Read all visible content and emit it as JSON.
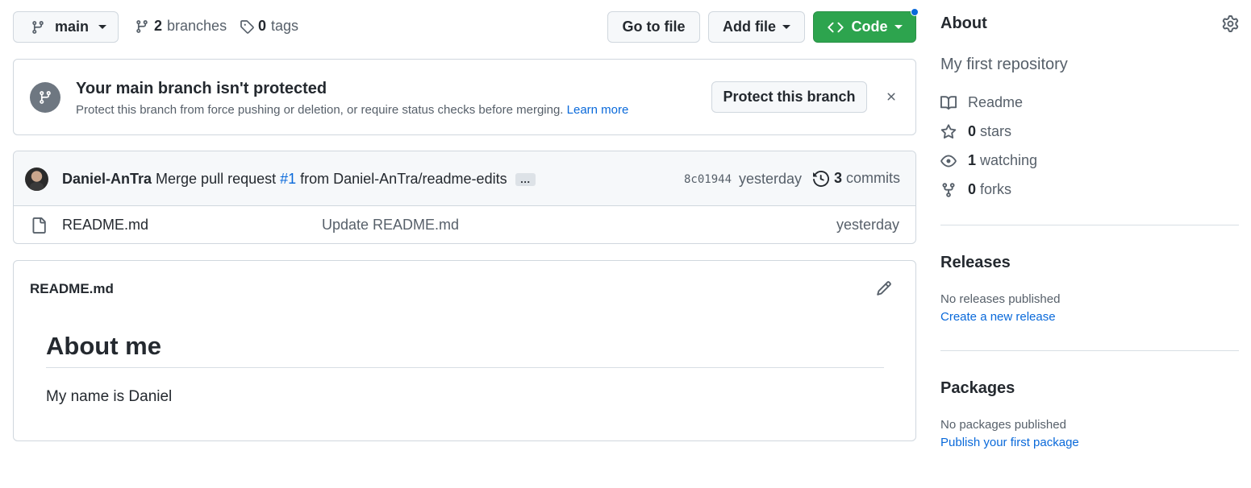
{
  "toolbar": {
    "branch_label": "main",
    "branches_count": "2",
    "branches_label": "branches",
    "tags_count": "0",
    "tags_label": "tags",
    "go_to_file": "Go to file",
    "add_file": "Add file",
    "code": "Code"
  },
  "protect_banner": {
    "title": "Your main branch isn't protected",
    "description": "Protect this branch from force pushing or deletion, or require status checks before merging.",
    "learn_more": "Learn more",
    "button": "Protect this branch"
  },
  "commit": {
    "author": "Daniel-AnTra",
    "message_prefix": "Merge pull request",
    "pr_number": "#1",
    "message_suffix": "from Daniel-AnTra/readme-edits",
    "ellipsis": "…",
    "sha": "8c01944",
    "time": "yesterday",
    "commits_count": "3",
    "commits_label": "commits"
  },
  "files": [
    {
      "name": "README.md",
      "message": "Update README.md",
      "time": "yesterday"
    }
  ],
  "readme": {
    "filename": "README.md",
    "heading": "About me",
    "body": "My name is Daniel"
  },
  "sidebar": {
    "about_title": "About",
    "description": "My first repository",
    "readme": "Readme",
    "stars_count": "0",
    "stars_label": "stars",
    "watching_count": "1",
    "watching_label": "watching",
    "forks_count": "0",
    "forks_label": "forks",
    "releases_title": "Releases",
    "releases_empty": "No releases published",
    "releases_link": "Create a new release",
    "packages_title": "Packages",
    "packages_empty": "No packages published",
    "packages_link": "Publish your first package"
  },
  "colors": {
    "primary_green": "#2da44e",
    "link_blue": "#0969da",
    "border": "#d0d7de",
    "notification_dot": "#0969da"
  },
  "icons": [
    "git-branch-icon",
    "tag-icon",
    "code-icon",
    "shield-branch-icon",
    "close-icon",
    "avatar",
    "history-icon",
    "file-icon",
    "pencil-icon",
    "gear-icon",
    "book-icon",
    "star-icon",
    "eye-icon",
    "repo-forked-icon"
  ]
}
